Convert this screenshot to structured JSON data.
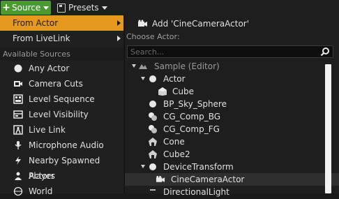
{
  "toolbar": {
    "source_label": "Source",
    "presets_label": "Presets"
  },
  "left_menu": {
    "items": [
      {
        "label": "From Actor"
      },
      {
        "label": "From LiveLink"
      }
    ],
    "section_label": "Available Sources",
    "sources": [
      {
        "label": "Any Actor",
        "icon": "sphere-icon"
      },
      {
        "label": "Camera Cuts",
        "icon": "camera-cuts-icon"
      },
      {
        "label": "Level Sequence",
        "icon": "level-sequence-icon"
      },
      {
        "label": "Level Visibility",
        "icon": "level-visibility-icon"
      },
      {
        "label": "Live Link",
        "icon": "live-link-icon"
      },
      {
        "label": "Microphone Audio",
        "icon": "microphone-icon"
      },
      {
        "label": "Nearby Spawned Actors",
        "icon": "spawn-icon"
      },
      {
        "label": "Player",
        "icon": "player-icon"
      },
      {
        "label": "World",
        "icon": "world-icon"
      }
    ]
  },
  "right_panel": {
    "add_label": "Add 'CineCameraActor'",
    "choose_label": "Choose Actor:",
    "search_placeholder": "Search...",
    "tree": [
      {
        "label": "Sample (Editor)",
        "dim": true
      },
      {
        "label": "Actor"
      },
      {
        "label": "Cube"
      },
      {
        "label": "BP_Sky_Sphere"
      },
      {
        "label": "CG_Comp_BG"
      },
      {
        "label": "CG_Comp_FG"
      },
      {
        "label": "Cone"
      },
      {
        "label": "Cube2"
      },
      {
        "label": "DeviceTransform"
      },
      {
        "label": "CineCameraActor"
      },
      {
        "label": "DirectionalLight"
      }
    ]
  },
  "colors": {
    "accent": "#e59a1f",
    "source_button": "#4a9a32"
  }
}
